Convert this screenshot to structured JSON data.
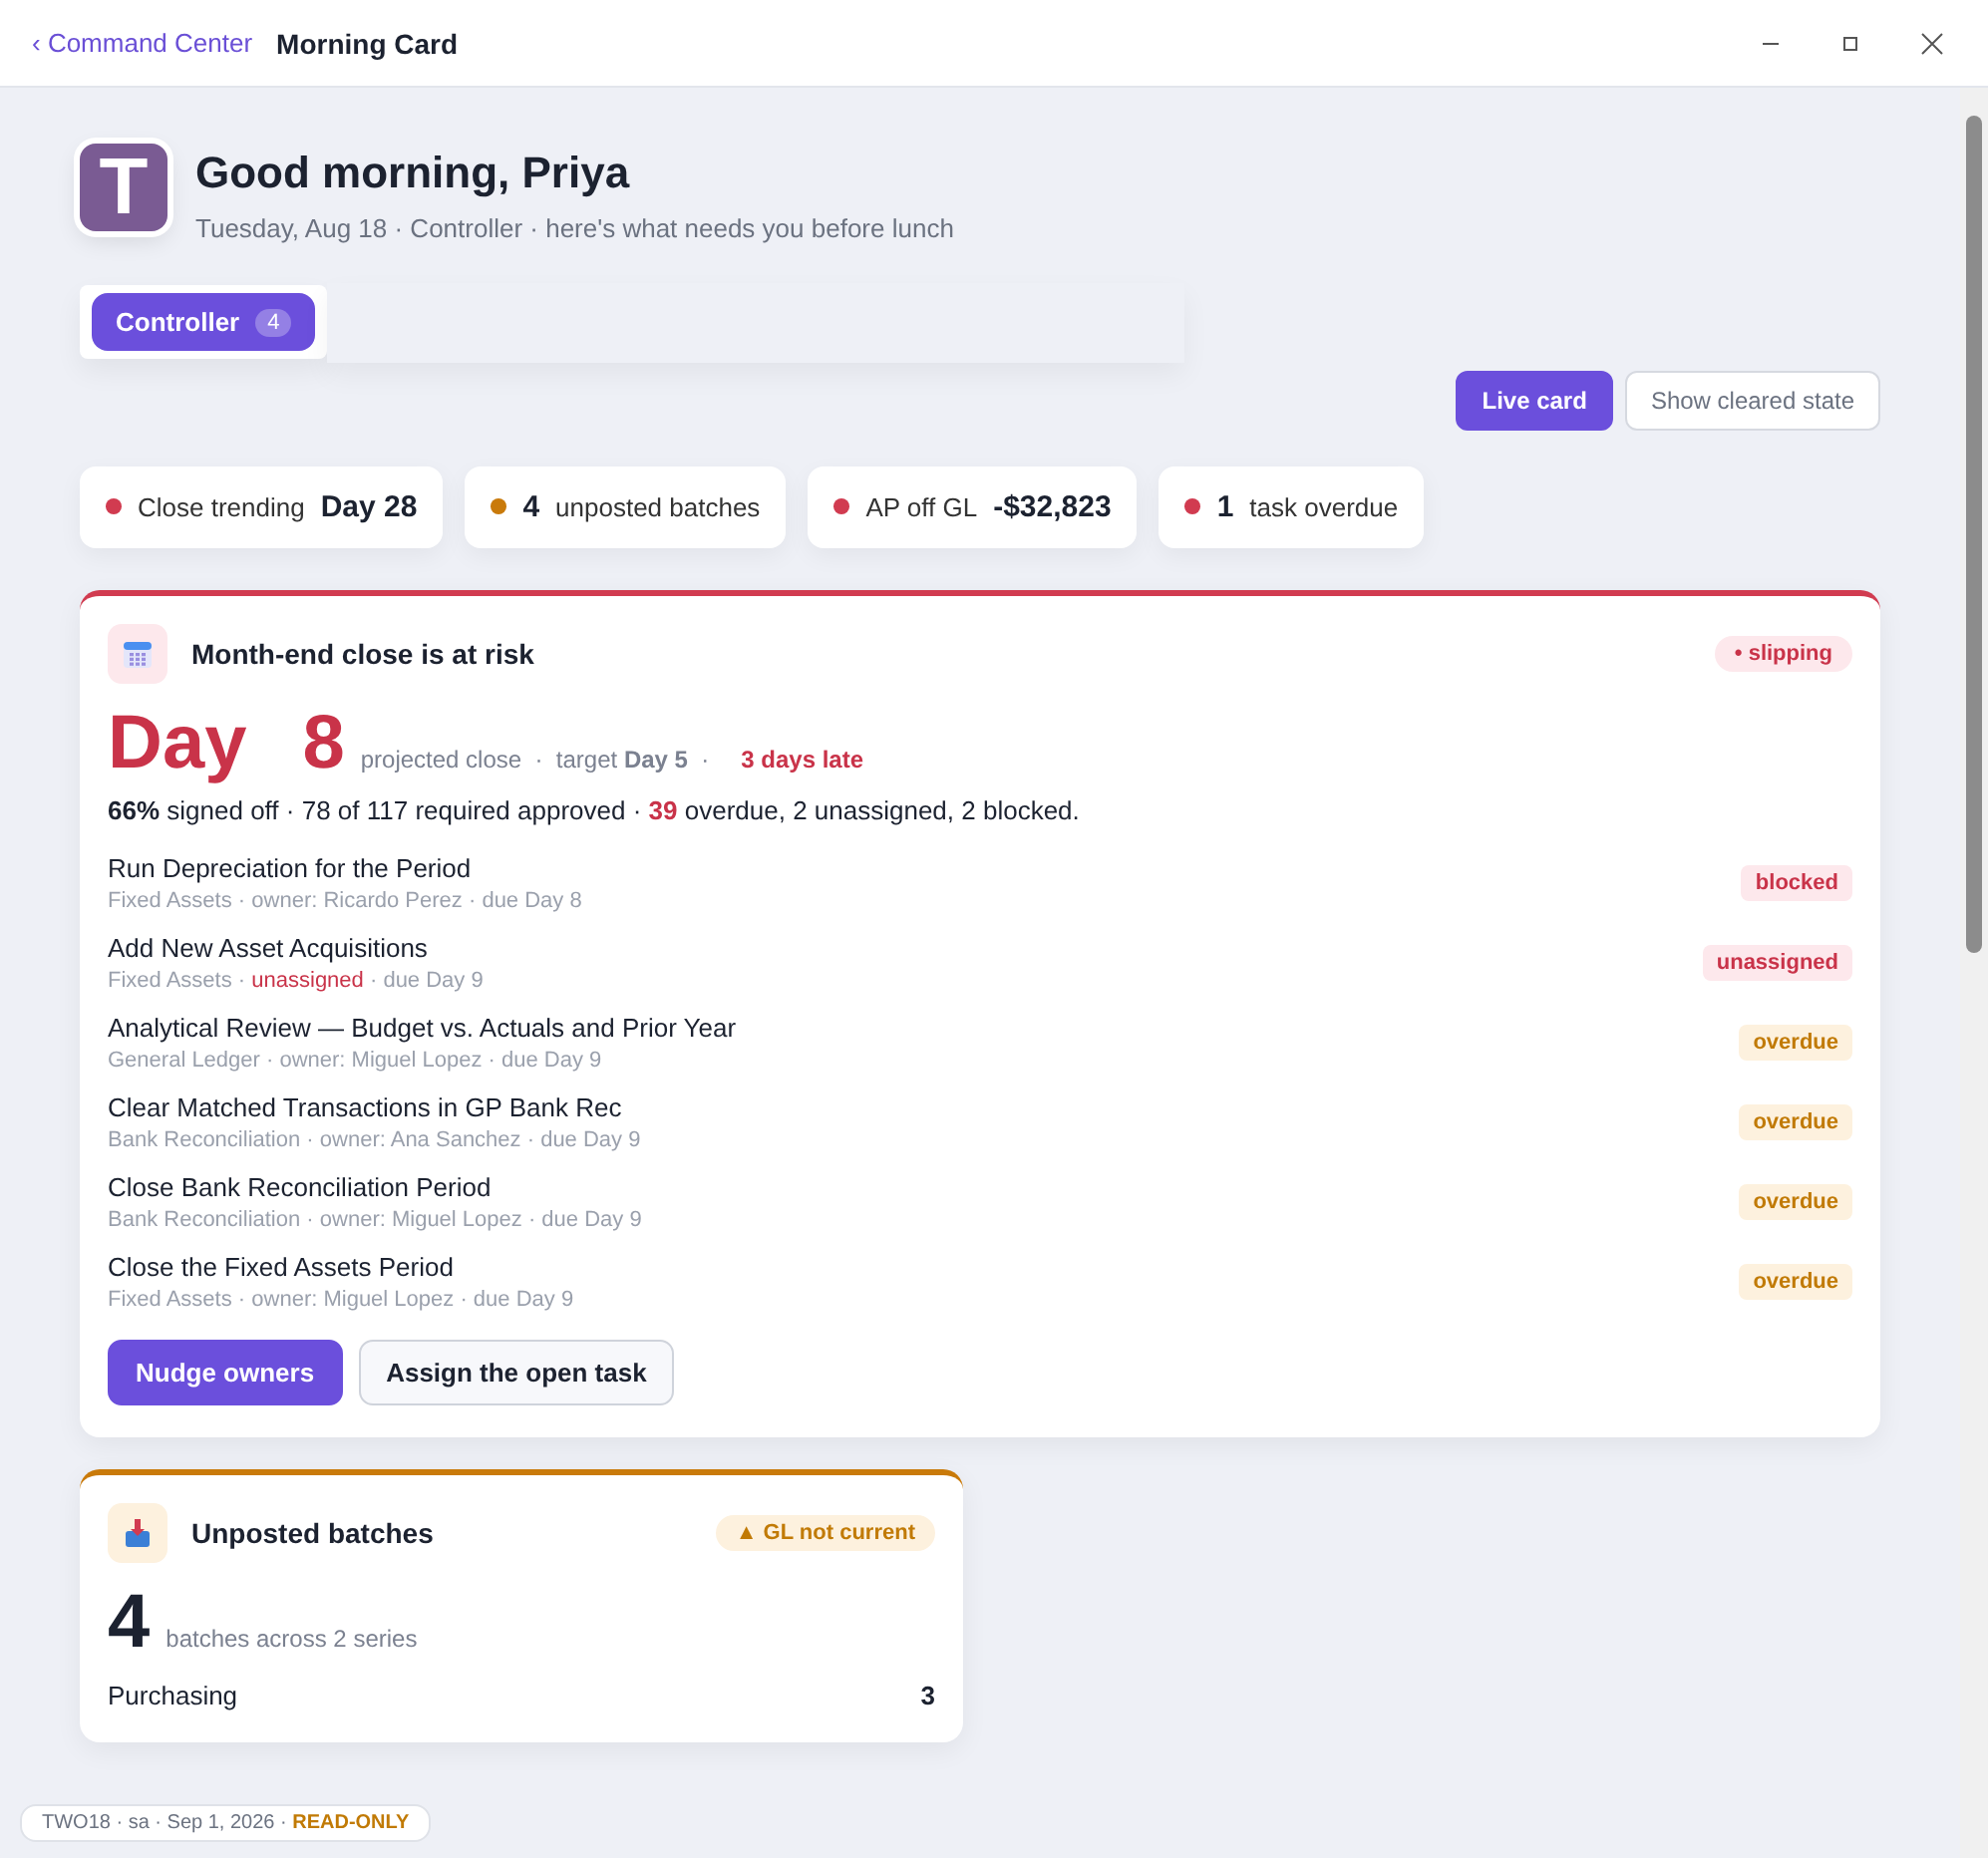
{
  "window": {
    "back_link": "‹ Command Center",
    "title": "Morning Card"
  },
  "header": {
    "logo_letter": "T",
    "greeting": "Good morning, Priya",
    "subtitle": "Tuesday, Aug 18 · Controller · here's what needs you before lunch"
  },
  "role_tabs": [
    {
      "label": "Controller",
      "count": "4",
      "selected": true
    }
  ],
  "view_toggle": [
    {
      "label": "Live card",
      "selected": true
    },
    {
      "label": "Show cleared state",
      "selected": false
    }
  ],
  "stats": [
    {
      "kind": "label_first",
      "color": "#d13b50",
      "label": "Close trending",
      "value": "Day 28"
    },
    {
      "kind": "value_first",
      "color": "#c97a0a",
      "label": "unposted batches",
      "value": "4"
    },
    {
      "kind": "label_first",
      "color": "#d13b50",
      "label": "AP off GL",
      "value": "-$32,823"
    },
    {
      "kind": "value_first",
      "color": "#d13b50",
      "label": "task overdue",
      "value": "1"
    }
  ],
  "close_card": {
    "title": "Month-end close is at risk",
    "status": "• slipping",
    "big_word": "Day",
    "big_number": "8",
    "projection": "projected close  ·  target **Day 5**  ·",
    "late": "3 days late",
    "summary_lead": "**66%** signed off · 78 of 117 required approved · ",
    "summary_highlight": "39",
    "summary_rest": " overdue, 2 unassigned, 2 blocked.",
    "tasks": [
      {
        "kind": "danger",
        "title": "Run Depreciation for the Period",
        "area": "Fixed Assets · ",
        "owner": "owner: Ricardo Perez",
        "owner_missing": false,
        "due": " · due Day 8",
        "badge": "blocked"
      },
      {
        "kind": "danger",
        "title": "Add New Asset Acquisitions",
        "area": "Fixed Assets · ",
        "owner": "unassigned",
        "owner_missing": true,
        "due": " · due Day 9",
        "badge": "unassigned"
      },
      {
        "kind": "warning",
        "title": "Analytical Review — Budget vs. Actuals and Prior Year",
        "area": "General Ledger · ",
        "owner": "owner: Miguel Lopez",
        "owner_missing": false,
        "due": " · due Day 9",
        "badge": "overdue"
      },
      {
        "kind": "warning",
        "title": "Clear Matched Transactions in GP Bank Rec",
        "area": "Bank Reconciliation · ",
        "owner": "owner: Ana Sanchez",
        "owner_missing": false,
        "due": " · due Day 9",
        "badge": "overdue"
      },
      {
        "kind": "warning",
        "title": "Close Bank Reconciliation Period",
        "area": "Bank Reconciliation · ",
        "owner": "owner: Miguel Lopez",
        "owner_missing": false,
        "due": " · due Day 9",
        "badge": "overdue"
      },
      {
        "kind": "warning",
        "title": "Close the Fixed Assets Period",
        "area": "Fixed Assets · ",
        "owner": "owner: Miguel Lopez",
        "owner_missing": false,
        "due": " · due Day 9",
        "badge": "overdue"
      }
    ],
    "actions": [
      {
        "label": "Nudge owners",
        "kind": "primary"
      },
      {
        "label": "Assign the open task",
        "kind": "secondary"
      }
    ]
  },
  "batches_card": {
    "title": "Unposted batches",
    "status": "▲ GL not current",
    "big_number": "4",
    "caption": "batches across 2 series",
    "rows": [
      {
        "name": "Purchasing",
        "count": "3"
      }
    ]
  },
  "footer_badge": {
    "text": "TWO18 · sa · Sep 1, 2026 · ",
    "mode": "READ-ONLY"
  }
}
